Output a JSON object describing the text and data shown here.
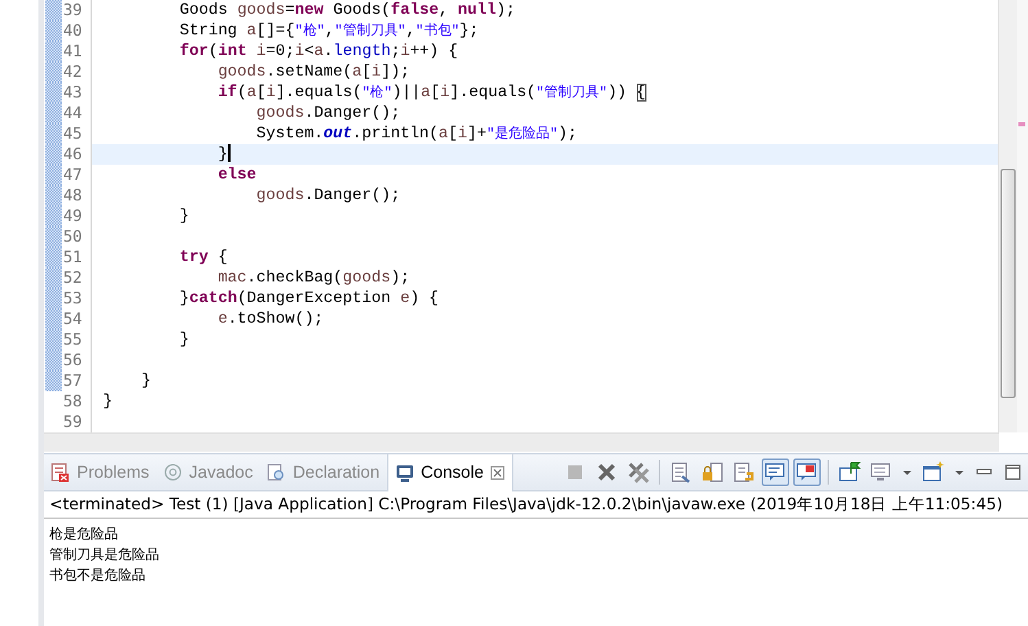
{
  "editor": {
    "lines": [
      {
        "number": "39",
        "modified": true,
        "selected": false,
        "tokens": [
          {
            "kind": "plain",
            "text": "        Goods "
          },
          {
            "kind": "local",
            "text": "goods"
          },
          {
            "kind": "plain",
            "text": "="
          },
          {
            "kind": "keyword",
            "text": "new"
          },
          {
            "kind": "plain",
            "text": " Goods("
          },
          {
            "kind": "keyword",
            "text": "false"
          },
          {
            "kind": "plain",
            "text": ", "
          },
          {
            "kind": "keyword",
            "text": "null"
          },
          {
            "kind": "plain",
            "text": ");"
          }
        ]
      },
      {
        "number": "40",
        "modified": true,
        "selected": false,
        "tokens": [
          {
            "kind": "plain",
            "text": "        String "
          },
          {
            "kind": "local",
            "text": "a"
          },
          {
            "kind": "plain",
            "text": "[]={"
          },
          {
            "kind": "string",
            "text": "\"枪\""
          },
          {
            "kind": "plain",
            "text": ","
          },
          {
            "kind": "string",
            "text": "\"管制刀具\""
          },
          {
            "kind": "plain",
            "text": ","
          },
          {
            "kind": "string",
            "text": "\"书包\""
          },
          {
            "kind": "plain",
            "text": "};"
          }
        ]
      },
      {
        "number": "41",
        "modified": true,
        "selected": false,
        "tokens": [
          {
            "kind": "keyword",
            "text": "        for"
          },
          {
            "kind": "plain",
            "text": "("
          },
          {
            "kind": "keyword",
            "text": "int"
          },
          {
            "kind": "local",
            "text": " i"
          },
          {
            "kind": "plain",
            "text": "=0;"
          },
          {
            "kind": "local",
            "text": "i"
          },
          {
            "kind": "plain",
            "text": "<"
          },
          {
            "kind": "local",
            "text": "a"
          },
          {
            "kind": "plain",
            "text": "."
          },
          {
            "kind": "field",
            "text": "length"
          },
          {
            "kind": "plain",
            "text": ";"
          },
          {
            "kind": "local",
            "text": "i"
          },
          {
            "kind": "plain",
            "text": "++) {"
          }
        ]
      },
      {
        "number": "42",
        "modified": true,
        "selected": false,
        "tokens": [
          {
            "kind": "local",
            "text": "            goods"
          },
          {
            "kind": "plain",
            "text": ".setName("
          },
          {
            "kind": "local",
            "text": "a"
          },
          {
            "kind": "plain",
            "text": "["
          },
          {
            "kind": "local",
            "text": "i"
          },
          {
            "kind": "plain",
            "text": "]);"
          }
        ]
      },
      {
        "number": "43",
        "modified": true,
        "selected": false,
        "tokens": [
          {
            "kind": "keyword",
            "text": "            if"
          },
          {
            "kind": "plain",
            "text": "("
          },
          {
            "kind": "local",
            "text": "a"
          },
          {
            "kind": "plain",
            "text": "["
          },
          {
            "kind": "local",
            "text": "i"
          },
          {
            "kind": "plain",
            "text": "].equals("
          },
          {
            "kind": "string",
            "text": "\"枪\""
          },
          {
            "kind": "plain",
            "text": ")||"
          },
          {
            "kind": "local",
            "text": "a"
          },
          {
            "kind": "plain",
            "text": "["
          },
          {
            "kind": "local",
            "text": "i"
          },
          {
            "kind": "plain",
            "text": "].equals("
          },
          {
            "kind": "string",
            "text": "\"管制刀具\""
          },
          {
            "kind": "plain",
            "text": ")) "
          },
          {
            "kind": "bracket",
            "text": "{"
          }
        ]
      },
      {
        "number": "44",
        "modified": true,
        "selected": false,
        "tokens": [
          {
            "kind": "local",
            "text": "                goods"
          },
          {
            "kind": "plain",
            "text": ".Danger();"
          }
        ]
      },
      {
        "number": "45",
        "modified": true,
        "selected": false,
        "tokens": [
          {
            "kind": "plain",
            "text": "                System."
          },
          {
            "kind": "static",
            "text": "out"
          },
          {
            "kind": "plain",
            "text": ".println("
          },
          {
            "kind": "local",
            "text": "a"
          },
          {
            "kind": "plain",
            "text": "["
          },
          {
            "kind": "local",
            "text": "i"
          },
          {
            "kind": "plain",
            "text": "]+"
          },
          {
            "kind": "string",
            "text": "\"是危险品\""
          },
          {
            "kind": "plain",
            "text": ");"
          }
        ]
      },
      {
        "number": "46",
        "modified": true,
        "selected": true,
        "tokens": [
          {
            "kind": "plain",
            "text": "            }"
          }
        ]
      },
      {
        "number": "47",
        "modified": true,
        "selected": false,
        "tokens": [
          {
            "kind": "keyword",
            "text": "            else"
          }
        ]
      },
      {
        "number": "48",
        "modified": true,
        "selected": false,
        "tokens": [
          {
            "kind": "local",
            "text": "                goods"
          },
          {
            "kind": "plain",
            "text": ".Danger();"
          }
        ]
      },
      {
        "number": "49",
        "modified": true,
        "selected": false,
        "tokens": [
          {
            "kind": "plain",
            "text": "        }"
          }
        ]
      },
      {
        "number": "50",
        "modified": true,
        "selected": false
      },
      {
        "number": "51",
        "modified": true,
        "selected": false,
        "tokens": [
          {
            "kind": "keyword",
            "text": "        try"
          },
          {
            "kind": "plain",
            "text": " {"
          }
        ]
      },
      {
        "number": "52",
        "modified": true,
        "selected": false,
        "tokens": [
          {
            "kind": "local",
            "text": "            mac"
          },
          {
            "kind": "plain",
            "text": ".checkBag("
          },
          {
            "kind": "local",
            "text": "goods"
          },
          {
            "kind": "plain",
            "text": ");"
          }
        ]
      },
      {
        "number": "53",
        "modified": true,
        "selected": false,
        "tokens": [
          {
            "kind": "plain",
            "text": "        }"
          },
          {
            "kind": "keyword",
            "text": "catch"
          },
          {
            "kind": "plain",
            "text": "(DangerException "
          },
          {
            "kind": "local",
            "text": "e"
          },
          {
            "kind": "plain",
            "text": ") {"
          }
        ]
      },
      {
        "number": "54",
        "modified": true,
        "selected": false,
        "tokens": [
          {
            "kind": "local",
            "text": "            e"
          },
          {
            "kind": "plain",
            "text": ".toShow();"
          }
        ]
      },
      {
        "number": "55",
        "modified": true,
        "selected": false,
        "tokens": [
          {
            "kind": "plain",
            "text": "        }"
          }
        ]
      },
      {
        "number": "56",
        "modified": true,
        "selected": false
      },
      {
        "number": "57",
        "modified": true,
        "selected": false,
        "tokens": [
          {
            "kind": "plain",
            "text": "    }"
          }
        ]
      },
      {
        "number": "58",
        "modified": false,
        "selected": false,
        "tokens": [
          {
            "kind": "plain",
            "text": "}"
          }
        ]
      },
      {
        "number": "59",
        "modified": false,
        "selected": false
      }
    ]
  },
  "console_view": {
    "tabs": [
      {
        "kind": "problems",
        "label": "Problems",
        "selected": false
      },
      {
        "kind": "javadoc",
        "label": "Javadoc",
        "selected": false
      },
      {
        "kind": "declaration",
        "label": "Declaration",
        "selected": false
      },
      {
        "kind": "console",
        "label": "Console",
        "selected": true
      }
    ],
    "toolbar": [
      {
        "kind": "terminate",
        "disabled": true
      },
      {
        "kind": "remove-launch",
        "disabled": false
      },
      {
        "kind": "remove-all",
        "disabled": false
      },
      {
        "kind": "separator"
      },
      {
        "kind": "clear"
      },
      {
        "kind": "scroll-lock"
      },
      {
        "kind": "word-wrap"
      },
      {
        "kind": "show-on-output",
        "pressed": true
      },
      {
        "kind": "show-on-error",
        "pressed": true
      },
      {
        "kind": "separator"
      },
      {
        "kind": "pin"
      },
      {
        "kind": "display-console"
      },
      {
        "kind": "dropdown"
      },
      {
        "kind": "open-console"
      },
      {
        "kind": "dropdown"
      },
      {
        "kind": "minimize"
      },
      {
        "kind": "maximize"
      }
    ],
    "header": "<terminated> Test (1) [Java Application] C:\\Program Files\\Java\\jdk-12.0.2\\bin\\javaw.exe (2019年10月18日 上午11:05:45)",
    "output": [
      "枪是危险品",
      "管制刀具是危险品",
      "书包不是危险品"
    ]
  }
}
